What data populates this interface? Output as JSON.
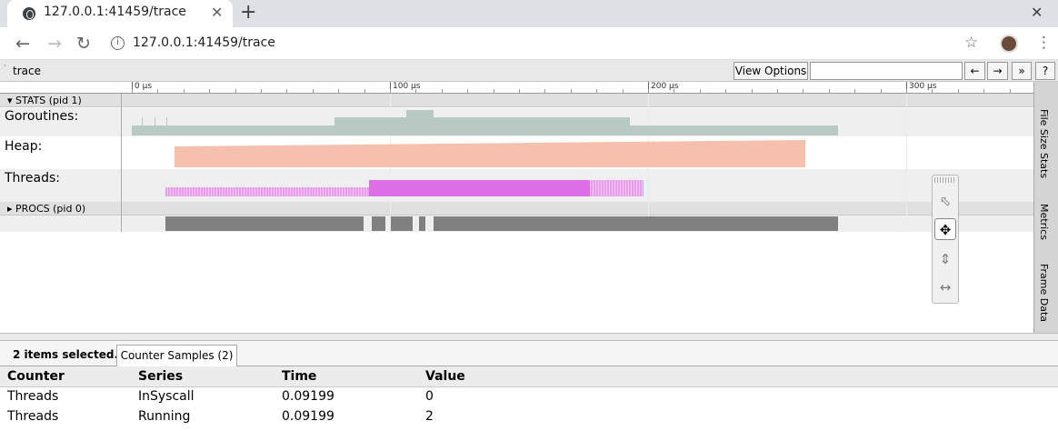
{
  "browser": {
    "tab_title": "127.0.0.1:41459/trace",
    "url": "127.0.0.1:41459/trace",
    "new_tab_label": "+",
    "close_tab_label": "✕",
    "window_close_label": "✕"
  },
  "trace": {
    "name": "trace",
    "view_options_label": "View Options",
    "search_value": "",
    "prev_label": "←",
    "next_label": "→",
    "expand_label": "»",
    "help_label": "?"
  },
  "ruler": {
    "labels": [
      "0 μs",
      "100 μs",
      "200 μs",
      "300 μs"
    ]
  },
  "sections": {
    "stats": "▾ STATS (pid 1)",
    "procs": "▸ PROCS (pid 0)"
  },
  "rows": {
    "goroutines": "Goroutines:",
    "heap": "Heap:",
    "threads": "Threads:"
  },
  "colors": {
    "goroutines": "#b7c9c2",
    "heap": "#f5c0ad",
    "threads_running": "#dc6fe6",
    "threads_syscall": "#e89cec",
    "procs": "#808080"
  },
  "side_tabs": [
    "File Size Stats",
    "Metrics",
    "Frame Data"
  ],
  "tools": [
    {
      "name": "selection",
      "icon": "pointer-icon",
      "active": false
    },
    {
      "name": "pan",
      "icon": "move-icon",
      "active": true
    },
    {
      "name": "zoom",
      "icon": "zoom-icon",
      "active": false
    },
    {
      "name": "timing",
      "icon": "timing-icon",
      "active": false
    }
  ],
  "panel": {
    "selection_text": "2 items selected.",
    "tab_label": "Counter Samples (2)",
    "columns": [
      "Counter",
      "Series",
      "Time",
      "Value"
    ],
    "rows": [
      [
        "Threads",
        "InSyscall",
        "0.09199",
        "0"
      ],
      [
        "Threads",
        "Running",
        "0.09199",
        "2"
      ]
    ]
  }
}
